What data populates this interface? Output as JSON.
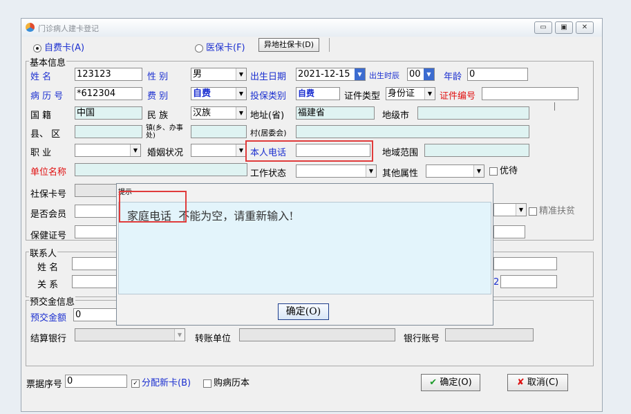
{
  "window": {
    "title": "门诊病人建卡登记"
  },
  "card_type": {
    "self_pay": "自费卡(A)",
    "insurance": "医保卡(F)",
    "remote_btn": "异地社保卡(D)"
  },
  "basic": {
    "group_title": "基本信息",
    "name_label": "姓    名",
    "name_value": "123123",
    "gender_label": "性    别",
    "gender_value": "男",
    "birth_label": "出生日期",
    "birth_value": "2021-12-15",
    "birth_hour_label": "出生时辰",
    "birth_hour_value": "00",
    "age_label": "年龄",
    "age_value": "0",
    "record_label": "病 历 号",
    "record_value": "*612304",
    "fee_label": "费    别",
    "fee_value": "自费",
    "insure_type_label": "投保类别",
    "insure_type_value": "自费",
    "id_type_label": "证件类型",
    "id_type_value": "身份证",
    "id_no_label": "证件编号",
    "id_no_value": "",
    "nation_label": "国    籍",
    "nation_value": "中国",
    "ethnic_label": "民    族",
    "ethnic_value": "汉族",
    "province_label": "地址(省)",
    "province_value": "福建省",
    "city_label": "地级市",
    "county_label": "县、  区",
    "town_label": "镇(乡、办事处)",
    "village_label": "村(居委会)",
    "job_label": "职    业",
    "marital_label": "婚姻状况",
    "phone_label": "本人电话",
    "region_label": "地域范围",
    "unit_label": "单位名称",
    "work_status_label": "工作状态",
    "other_attr_label": "其他属性",
    "priority_label": "优待",
    "social_card_label": "社保卡号",
    "member_label": "是否会员",
    "poverty_label": "精准扶贫",
    "health_card_label": "保健证号"
  },
  "contact": {
    "group_title": "联系人",
    "name_label": "姓  名",
    "relation_label": "关  系",
    "extra_label": "2"
  },
  "deposit": {
    "group_title": "预交金信息",
    "amount_label": "预交金额",
    "amount_value": "0",
    "bank_label": "结算银行",
    "transfer_label": "转账单位",
    "account_label": "银行账号"
  },
  "footer": {
    "receipt_label": "票据序号",
    "receipt_value": "0",
    "assign_card": "分配新卡(B)",
    "buy_book": "购病历本",
    "ok_btn": "确定(O)",
    "cancel_btn": "取消(C)"
  },
  "dialog": {
    "title": "提示",
    "field_name": "家庭电话",
    "message": "不能为空，请重新输入!",
    "ok_btn": "确定(O)"
  },
  "colors": {
    "accent_red": "#e03a3a",
    "label_blue": "#1b2fd0",
    "readonly_bg": "#dff3f2"
  }
}
